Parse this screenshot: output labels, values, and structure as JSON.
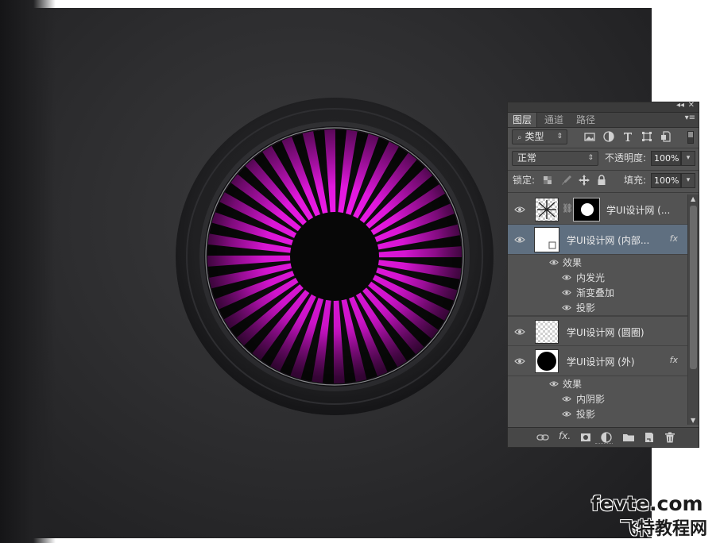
{
  "panel": {
    "tabs": [
      "图层",
      "通道",
      "路径"
    ],
    "filter_kind": "类型",
    "blend_mode": "正常",
    "opacity_label": "不透明度:",
    "opacity_value": "100%",
    "lock_label": "锁定:",
    "fill_label": "填充:",
    "fill_value": "100%"
  },
  "layers": [
    {
      "name": "学UI设计网 (...",
      "has_mask": true,
      "fx": "",
      "effects_label": "",
      "effects": []
    },
    {
      "name": "学UI设计网 (内部...",
      "has_mask": false,
      "fx": "fx",
      "effects_label": "效果",
      "effects": [
        "内发光",
        "渐变叠加",
        "投影"
      ],
      "selected": true
    },
    {
      "name": "学UI设计网 (圆圈)",
      "has_mask": false,
      "fx": "",
      "effects_label": "",
      "effects": []
    },
    {
      "name": "学UI设计网 (外)",
      "has_mask": false,
      "fx": "fx",
      "effects_label": "效果",
      "effects": [
        "内阴影",
        "投影"
      ]
    }
  ],
  "watermark": {
    "top": "fevte.com",
    "bottom": "飞特教程网"
  },
  "colors": {
    "magenta": "#e016e0",
    "canvas": "#2e2e30",
    "panel_bg": "#535353",
    "selected_row": "#5f6f80"
  },
  "art": {
    "ray_count": 36
  }
}
